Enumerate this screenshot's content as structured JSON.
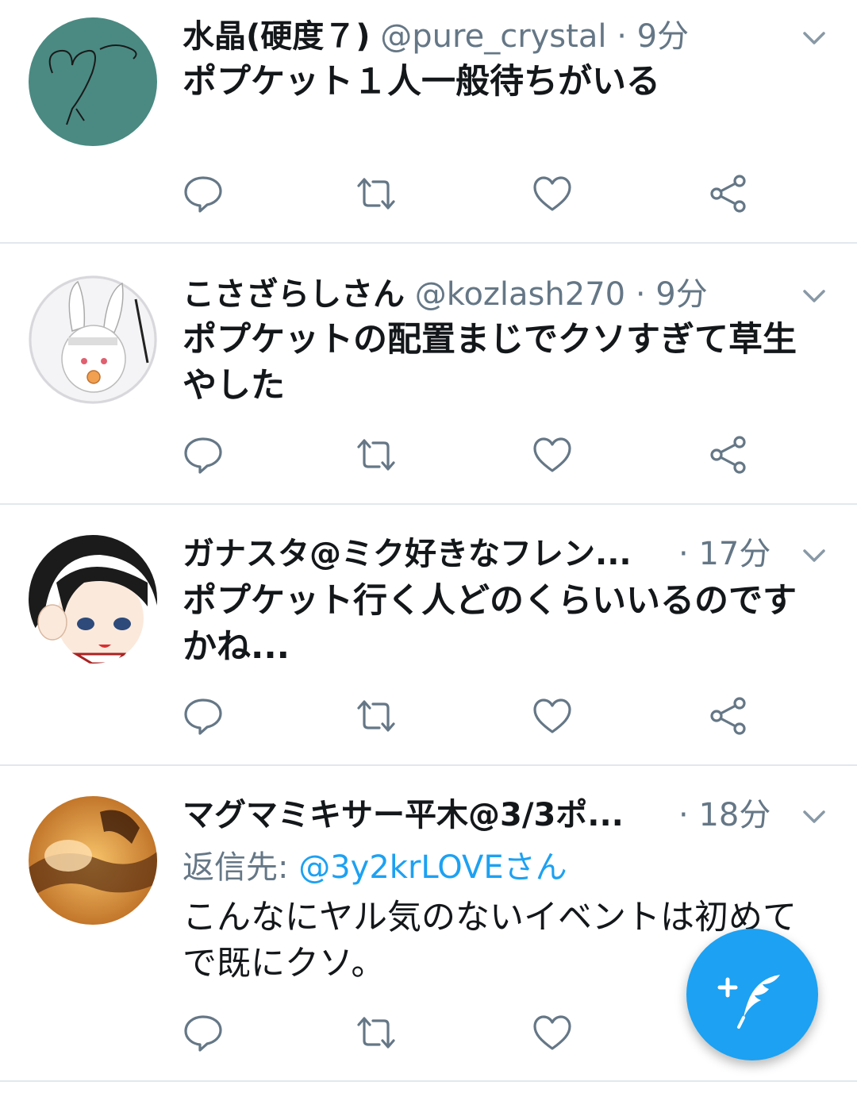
{
  "tweets": [
    {
      "name": "水晶(硬度７)",
      "handle": "@pure_crystal",
      "sep": "·",
      "time": "9分",
      "text": "ポプケット１人一般待ちがいる",
      "avatar_color": "#4a8a82"
    },
    {
      "name": "こさざらしさん",
      "handle": "@kozlash270",
      "sep": "·",
      "time": "9分",
      "text": "ポプケットの配置まじでクソすぎて草生\nやした",
      "avatar_color": "#f2f2f2"
    },
    {
      "name": "ガナスタ@ミク好きなフレン...",
      "handle": "",
      "sep": "·",
      "time": "17分",
      "text": "ポプケット行く人どのくらいいるのです\nかね...",
      "avatar_color": "#222222"
    },
    {
      "name": "マグマミキサー平木@3/3ポ...",
      "handle": "",
      "sep": "·",
      "time": "18分",
      "reply_prefix": "返信先: ",
      "reply_to": "@3y2krLOVEさん",
      "text": "こんなにヤル気のないイベントは初めて\nで既にクソ。",
      "avatar_color": "#d9902f"
    }
  ],
  "colors": {
    "accent": "#1da1f2",
    "icon": "#657786",
    "divider": "#e1e8ed"
  },
  "icons": [
    "reply-icon",
    "retweet-icon",
    "like-icon",
    "share-icon",
    "chevron-down-icon",
    "compose-tweet-icon"
  ]
}
